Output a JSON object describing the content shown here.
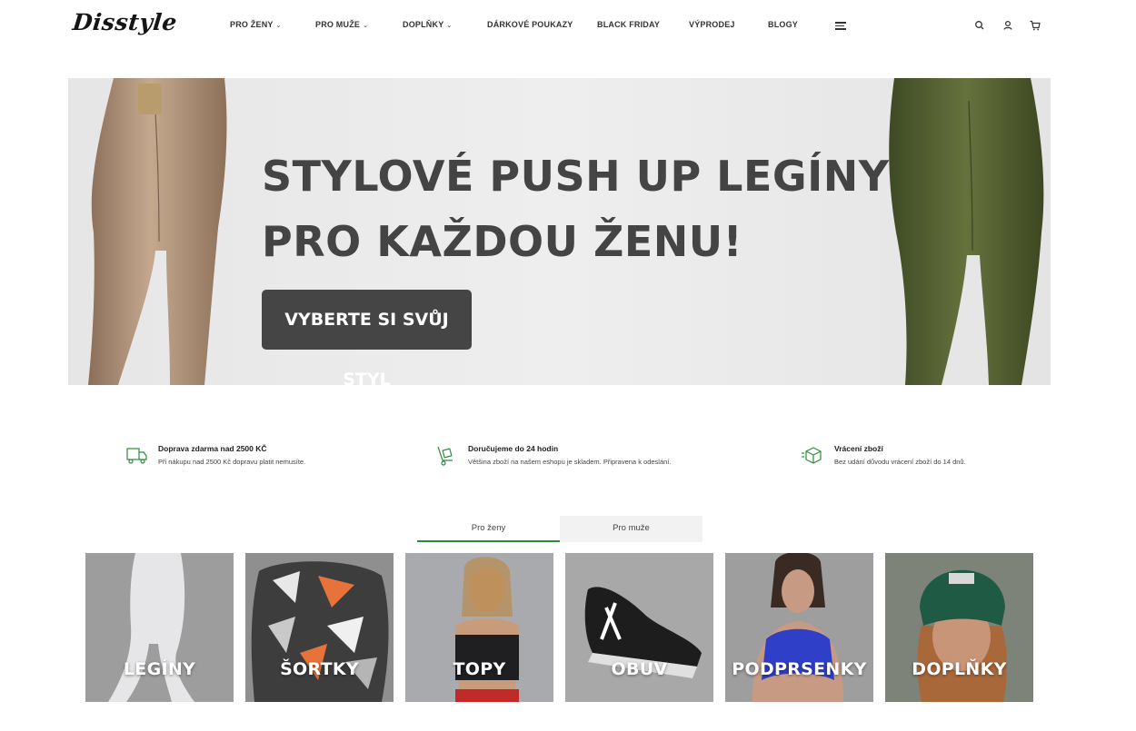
{
  "header": {
    "logo": "Disstyle",
    "nav": [
      {
        "label": "PRO ŽENY",
        "dropdown": true
      },
      {
        "label": "PRO MUŽE",
        "dropdown": true
      },
      {
        "label": "DOPLŇKY",
        "dropdown": true
      },
      {
        "label": "DÁRKOVÉ POUKAZY",
        "dropdown": false
      },
      {
        "label": "BLACK FRIDAY",
        "dropdown": false
      },
      {
        "label": "VÝPRODEJ",
        "dropdown": false
      },
      {
        "label": "BLOGY",
        "dropdown": false
      }
    ],
    "icons": [
      "menu-icon",
      "search-icon",
      "user-icon",
      "cart-icon"
    ]
  },
  "hero": {
    "title_line1": "STYLOVÉ PUSH UP LEGÍNY",
    "title_line2": "PRO KAŽDOU ŽENU!",
    "button_label": "VYBERTE SI SVŮJ STYL"
  },
  "benefits": [
    {
      "icon": "truck-icon",
      "title": "Doprava zdarma nad 2500 KČ",
      "text": "Při nákupu nad 2500 Kč dopravu platit nemusíte."
    },
    {
      "icon": "hand-truck-icon",
      "title": "Doručujeme do 24 hodin",
      "text": "Většina zboží na našem eshopu je skladem. Připravena k odeslání."
    },
    {
      "icon": "return-box-icon",
      "title": "Vrácení zboží",
      "text": "Bez udání důvodu vrácení zboží do 14 dnů."
    }
  ],
  "tabs": [
    {
      "label": "Pro ženy",
      "active": true
    },
    {
      "label": "Pro muže",
      "active": false
    }
  ],
  "categories": [
    {
      "label": "LEGÍNY"
    },
    {
      "label": "ŠORTKY"
    },
    {
      "label": "TOPY"
    },
    {
      "label": "OBUV"
    },
    {
      "label": "PODPRSENKY"
    },
    {
      "label": "DOPLŇKY"
    }
  ],
  "colors": {
    "accent_green": "#2e8b3e",
    "button_dark": "#454545",
    "hero_text": "#444444"
  }
}
